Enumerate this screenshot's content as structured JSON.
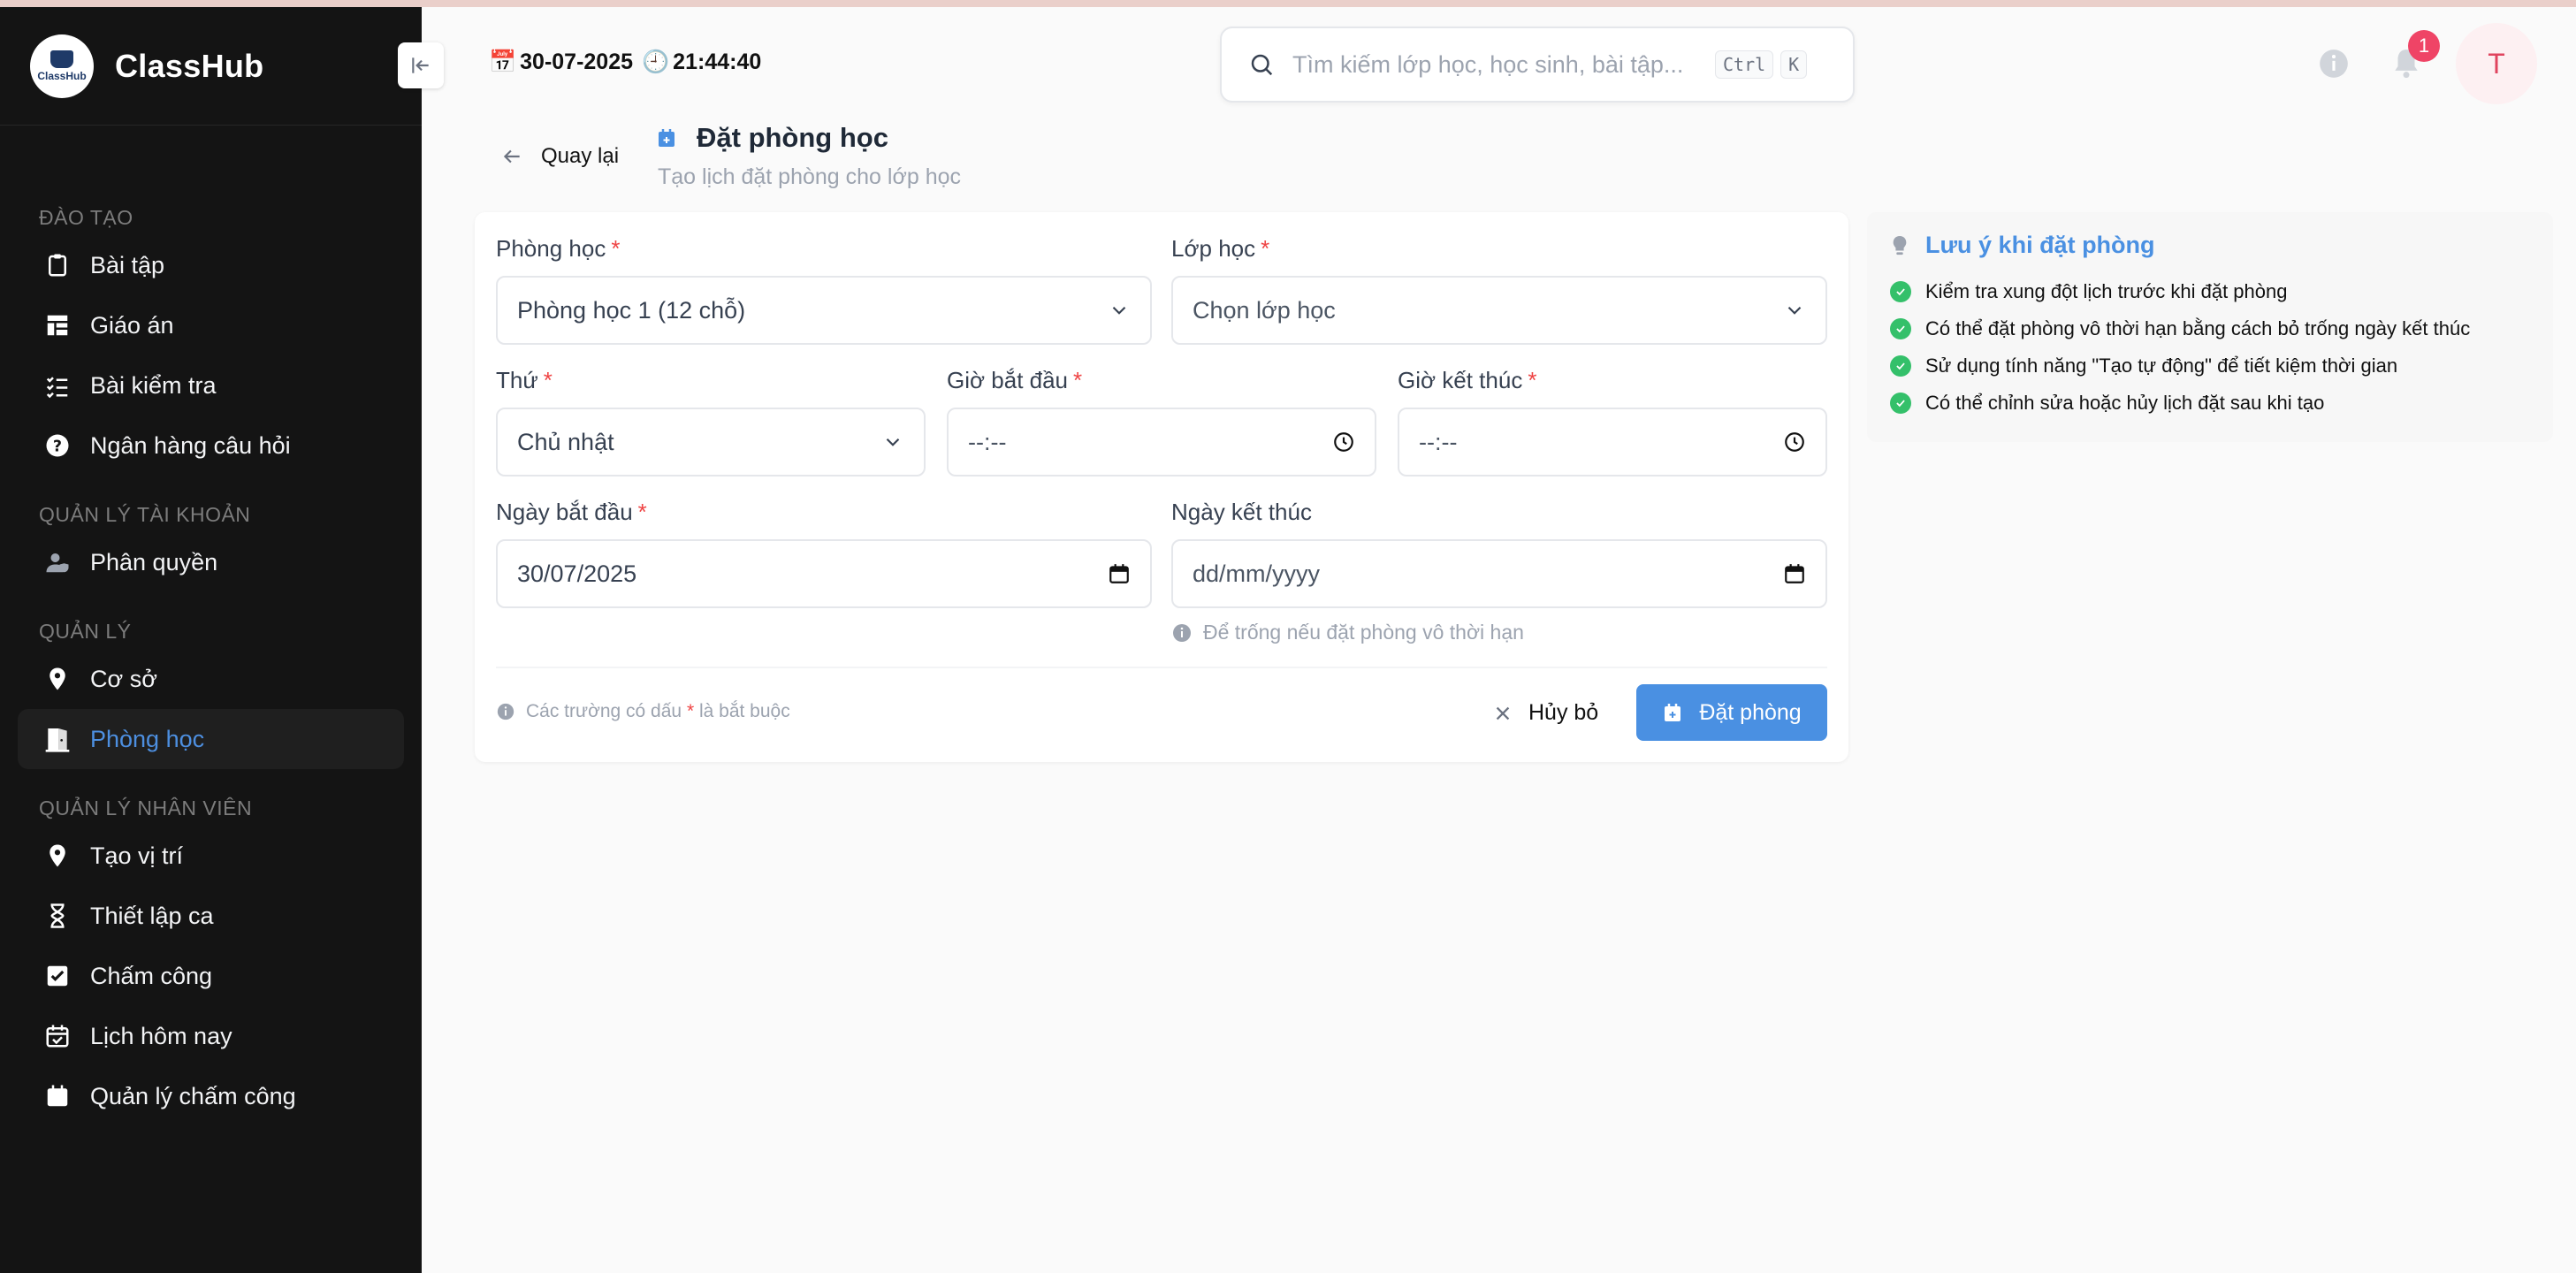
{
  "app": {
    "name": "ClassHub",
    "logo_text": "ClassHub"
  },
  "header": {
    "date": "30-07-2025",
    "time": "21:44:40",
    "search_placeholder": "Tìm kiếm lớp học, học sinh, bài tập...",
    "shortcut_keys": [
      "Ctrl",
      "K"
    ],
    "notification_count": "1",
    "avatar_initial": "T"
  },
  "sidebar": {
    "sections": [
      {
        "title": "ĐÀO TẠO",
        "items": [
          "Bài tập",
          "Giáo án",
          "Bài kiểm tra",
          "Ngân hàng câu hỏi"
        ]
      },
      {
        "title": "QUẢN LÝ TÀI KHOẢN",
        "items": [
          "Phân quyền"
        ]
      },
      {
        "title": "QUẢN LÝ",
        "items": [
          "Cơ sở",
          "Phòng học"
        ]
      },
      {
        "title": "QUẢN LÝ NHÂN VIÊN",
        "items": [
          "Tạo vị trí",
          "Thiết lập ca",
          "Chấm công",
          "Lịch hôm nay",
          "Quản lý chấm công"
        ]
      }
    ],
    "active_item": "Phòng học"
  },
  "page": {
    "back_label": "Quay lại",
    "title": "Đặt phòng học",
    "subtitle": "Tạo lịch đặt phòng cho lớp học"
  },
  "form": {
    "room": {
      "label": "Phòng học",
      "value": "Phòng học 1 (12 chỗ)"
    },
    "class": {
      "label": "Lớp học",
      "placeholder": "Chọn lớp học"
    },
    "weekday": {
      "label": "Thứ",
      "value": "Chủ nhật"
    },
    "start_time": {
      "label": "Giờ bắt đầu",
      "placeholder": "--:--"
    },
    "end_time": {
      "label": "Giờ kết thúc",
      "placeholder": "--:--"
    },
    "start_date": {
      "label": "Ngày bắt đầu",
      "value": "30/07/2025"
    },
    "end_date": {
      "label": "Ngày kết thúc",
      "placeholder": "dd/mm/yyyy",
      "hint": "Để trống nếu đặt phòng vô thời hạn"
    },
    "required_note_prefix": "Các trường có dấu",
    "required_note_star": "*",
    "required_note_suffix": "là bắt buộc",
    "cancel_label": "Hủy bỏ",
    "submit_label": "Đặt phòng"
  },
  "notes": {
    "title": "Lưu ý khi đặt phòng",
    "items": [
      "Kiểm tra xung đột lịch trước khi đặt phòng",
      "Có thể đặt phòng vô thời hạn bằng cách bỏ trống ngày kết thúc",
      "Sử dụng tính năng \"Tạo tự động\" để tiết kiệm thời gian",
      "Có thể chỉnh sửa hoặc hủy lịch đặt sau khi tạo"
    ]
  },
  "colors": {
    "accent": "#4a90e2",
    "sidebar_bg": "#141414",
    "required": "#ef4444",
    "success": "#34c06a"
  }
}
